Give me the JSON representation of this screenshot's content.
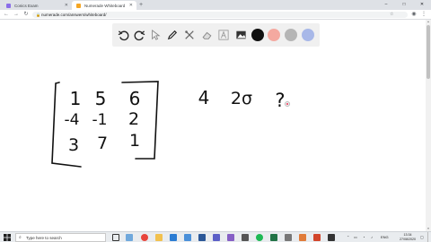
{
  "browser": {
    "tabs": [
      {
        "title": "Conics Exam",
        "active": false,
        "favicon_color": "#8a6de9"
      },
      {
        "title": "Numerade Whiteboard",
        "active": true,
        "favicon_color": "#f5a623"
      }
    ],
    "new_tab_icon": "plus-icon",
    "address": {
      "url": "numerade.com/answers/whiteboard/"
    },
    "window_controls": [
      "minimize-icon",
      "maximize-icon",
      "close-icon"
    ]
  },
  "toolbar": {
    "tools": [
      "undo-icon",
      "redo-icon",
      "select-icon",
      "pen-icon",
      "tools-icon",
      "eraser-icon",
      "text-icon",
      "image-icon"
    ],
    "colors": [
      "#111111",
      "#f4a9a0",
      "#b5b5b5",
      "#a8b8e8"
    ],
    "selected_color": "#111111"
  },
  "whiteboard": {
    "matrix": [
      [
        "1",
        "5",
        "6"
      ],
      [
        "-4",
        "-1",
        "2"
      ],
      [
        "3",
        "7",
        "1"
      ]
    ],
    "side_notes": [
      "4",
      "2σ",
      "?"
    ]
  },
  "taskbar": {
    "search_placeholder": "Type here to search",
    "apps": [
      {
        "name": "chrome",
        "color": "#e8453c",
        "active": true
      },
      {
        "name": "file-explorer",
        "color": "#f2c14e",
        "active": false
      },
      {
        "name": "mail",
        "color": "#2b7cd3",
        "active": false
      },
      {
        "name": "photos",
        "color": "#4a90d9",
        "active": false
      },
      {
        "name": "word",
        "color": "#2b5797",
        "active": false
      },
      {
        "name": "teams",
        "color": "#5b5fc7",
        "active": false
      },
      {
        "name": "visual-studio",
        "color": "#865fc5",
        "active": false
      },
      {
        "name": "calculator",
        "color": "#555555",
        "active": false
      },
      {
        "name": "spotify",
        "color": "#1db954",
        "active": false
      },
      {
        "name": "excel",
        "color": "#217346",
        "active": false
      },
      {
        "name": "settings",
        "color": "#777777",
        "active": false
      },
      {
        "name": "whiteboard-app",
        "color": "#e07b39",
        "active": false
      },
      {
        "name": "snip-tool",
        "color": "#d2452b",
        "active": false
      },
      {
        "name": "terminal",
        "color": "#333333",
        "active": false
      }
    ],
    "language": "ENG",
    "time": "13:34",
    "date": "27/08/2020"
  }
}
